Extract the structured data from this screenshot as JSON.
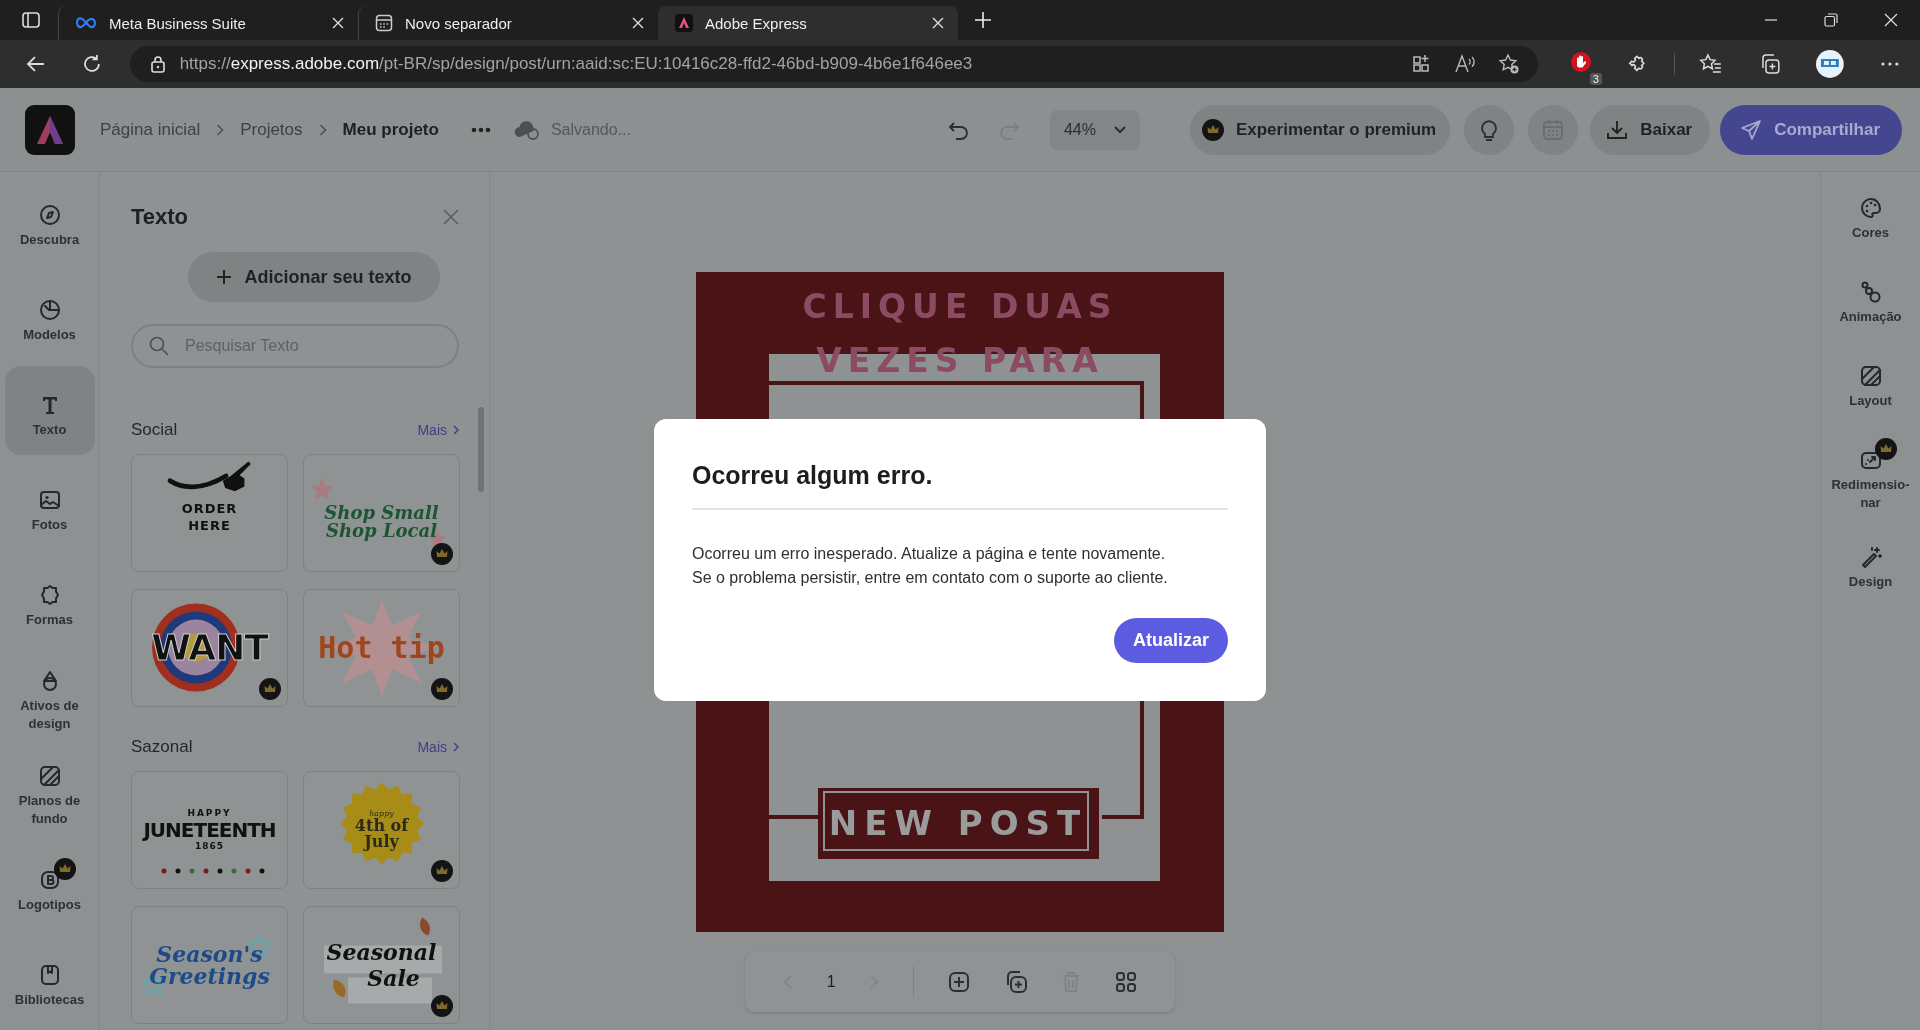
{
  "browser": {
    "tabs": [
      {
        "title": "Meta Business Suite",
        "selected": false
      },
      {
        "title": "Novo separador",
        "selected": false
      },
      {
        "title": "Adobe Express",
        "selected": true
      }
    ],
    "url": {
      "scheme": "https://",
      "host": "express.adobe.com",
      "path": "/pt-BR/sp/design/post/urn:aaid:sc:EU:10416c28-ffd2-46bd-b909-4b6e1f646ee3"
    },
    "extension_badge": "3"
  },
  "toolbar": {
    "breadcrumbs": [
      {
        "label": "Página inicial",
        "current": false
      },
      {
        "label": "Projetos",
        "current": false
      },
      {
        "label": "Meu projeto",
        "current": true
      }
    ],
    "status": "Salvando...",
    "redo_disabled": true,
    "zoom": "44%",
    "premium": "Experimentar o premium",
    "download": "Baixar",
    "share": "Compartilhar"
  },
  "left_rail": [
    {
      "label": "Descubra",
      "selected": false,
      "premium": false
    },
    {
      "label": "Modelos",
      "selected": false,
      "premium": false
    },
    {
      "label": "Texto",
      "selected": true,
      "premium": false
    },
    {
      "label": "Fotos",
      "selected": false,
      "premium": false
    },
    {
      "label": "Formas",
      "selected": false,
      "premium": false
    },
    {
      "label": "Ativos de design",
      "selected": false,
      "premium": false
    },
    {
      "label": "Planos de fundo",
      "selected": false,
      "premium": false
    },
    {
      "label": "Logotipos",
      "selected": false,
      "premium": true
    },
    {
      "label": "Bibliotecas",
      "selected": false,
      "premium": false
    }
  ],
  "panel": {
    "title": "Texto",
    "add_button": "Adicionar seu texto",
    "search": {
      "placeholder": "Pesquisar Texto"
    },
    "sections": [
      {
        "title": "Social",
        "more": "Mais",
        "items": [
          {
            "kind": "order",
            "lines": [
              "ORDER",
              "HERE"
            ],
            "premium": false
          },
          {
            "kind": "shop",
            "lines": [
              "Shop Small",
              "Shop Local"
            ],
            "premium": true
          },
          {
            "kind": "want",
            "lines": [
              "WANT"
            ],
            "premium": true
          },
          {
            "kind": "hottip",
            "lines": [
              "Hot tip"
            ],
            "premium": true
          }
        ]
      },
      {
        "title": "Sazonal",
        "more": "Mais",
        "items": [
          {
            "kind": "juneteenth",
            "lines": [
              "HAPPY",
              "JUNETEENTH",
              "1865"
            ],
            "premium": false
          },
          {
            "kind": "july",
            "lines": [
              "happy",
              "4th of",
              "July"
            ],
            "premium": true
          },
          {
            "kind": "greetings",
            "lines": [
              "Season's",
              "Greetings"
            ],
            "premium": false
          },
          {
            "kind": "sale",
            "lines": [
              "Seasonal",
              "Sale"
            ],
            "premium": true
          }
        ]
      }
    ]
  },
  "right_rail": [
    {
      "label": "Cores",
      "premium": false
    },
    {
      "label": "Animação",
      "premium": false
    },
    {
      "label": "Layout",
      "premium": false
    },
    {
      "label": "Redimensio-\nnar",
      "premium": true
    },
    {
      "label": "Design",
      "premium": false
    }
  ],
  "poster": {
    "lines": [
      "CLIQUE DUAS",
      "VEZES PARA"
    ],
    "badge": "NEW POST"
  },
  "pager": {
    "page": "1",
    "prev_disabled": true,
    "next_disabled": true,
    "delete_disabled": true
  },
  "dialog": {
    "title": "Ocorreu algum erro.",
    "body": [
      "Ocorreu um erro inesperado. Atualize a página e tente novamente.",
      "Se o problema persistir, entre em contato com o suporte ao cliente."
    ],
    "button": "Atualizar"
  }
}
